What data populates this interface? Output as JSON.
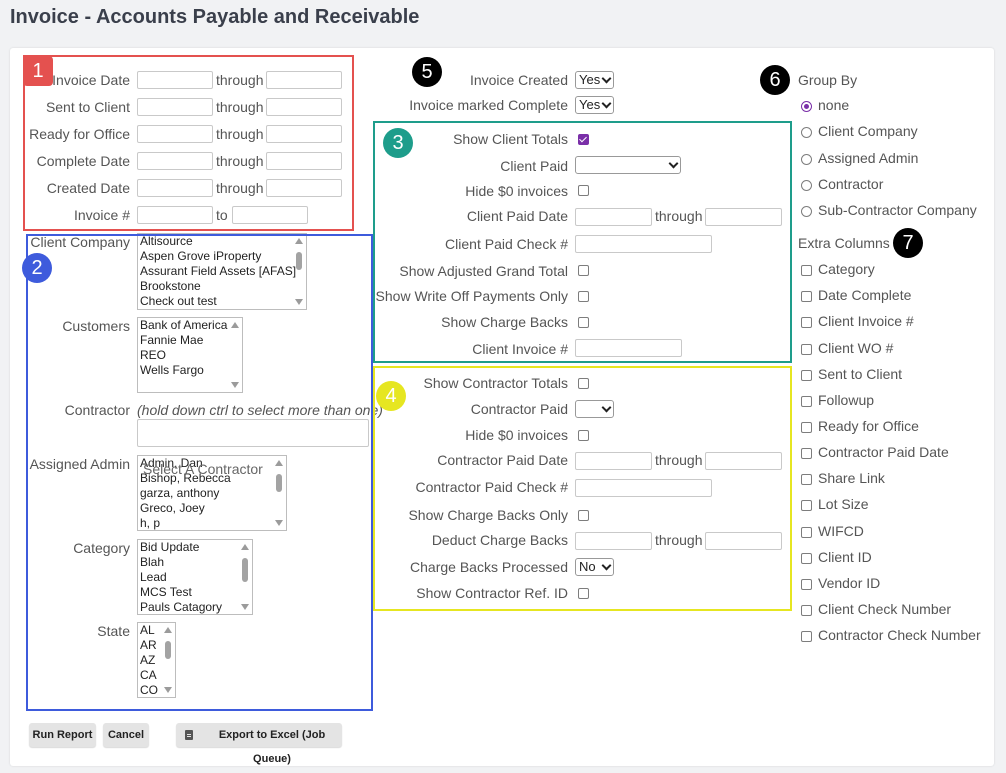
{
  "page": {
    "title": "Invoice - Accounts Payable and Receivable"
  },
  "colors": {
    "box1": "#e4514f",
    "box2": "#3e5bdc",
    "box3": "#1e9d8b",
    "box4": "#e6e621",
    "badge_black": "#000000",
    "accent": "#7a2fa8"
  },
  "badges": {
    "b1": "1",
    "b2": "2",
    "b3": "3",
    "b4": "4",
    "b5": "5",
    "b6": "6",
    "b7": "7"
  },
  "dates": {
    "invoice_date": "Invoice Date",
    "sent_to_client": "Sent to Client",
    "ready_for_office": "Ready for Office",
    "complete_date": "Complete Date",
    "created_date": "Created Date",
    "invoice_num": "Invoice #",
    "through": "through",
    "to": "to"
  },
  "filters": {
    "client_company": "Client Company",
    "client_company_options": [
      "Altisource",
      "Aspen Grove iProperty",
      "Assurant Field Assets [AFAS]",
      "Brookstone",
      "Check out test"
    ],
    "customers": "Customers",
    "customers_options": [
      "Bank of America",
      "Fannie Mae",
      "REO",
      "Wells Fargo"
    ],
    "contractor": "Contractor",
    "contractor_hint": "(hold down ctrl to select more than one)",
    "contractor_placeholder": "Select A Contractor",
    "assigned_admin": "Assigned Admin",
    "assigned_admin_options": [
      "Admin, Dan",
      "Bishop, Rebecca",
      "garza, anthony",
      "Greco, Joey",
      "h, p"
    ],
    "category": "Category",
    "category_options": [
      "Bid Update",
      "Blah",
      "Lead",
      "MCS Test",
      "Pauls Catagory"
    ],
    "state": "State",
    "state_options": [
      "AL",
      "AR",
      "AZ",
      "CA",
      "CO"
    ]
  },
  "invoice_flags": {
    "invoice_created": "Invoice Created",
    "invoice_created_value": "Yes",
    "invoice_marked_complete": "Invoice marked Complete",
    "invoice_marked_complete_value": "Yes"
  },
  "client": {
    "show_client_totals": "Show Client Totals",
    "client_paid": "Client Paid",
    "hide_zero": "Hide $0 invoices",
    "client_paid_date": "Client Paid Date",
    "client_paid_check": "Client Paid Check #",
    "show_adjusted": "Show Adjusted Grand Total",
    "show_write_off": "Show Write Off Payments Only",
    "show_charge_backs": "Show Charge Backs",
    "client_invoice": "Client Invoice #"
  },
  "contractor_section": {
    "show_contractor_totals": "Show Contractor Totals",
    "contractor_paid": "Contractor Paid",
    "hide_zero": "Hide $0 invoices",
    "contractor_paid_date": "Contractor Paid Date",
    "contractor_paid_check": "Contractor Paid Check #",
    "show_charge_backs_only": "Show Charge Backs Only",
    "deduct_charge_backs": "Deduct Charge Backs",
    "charge_backs_processed": "Charge Backs Processed",
    "charge_backs_processed_value": "No",
    "show_contractor_ref": "Show Contractor Ref. ID"
  },
  "group_by": {
    "title": "Group By",
    "options": [
      "none",
      "Client Company",
      "Assigned Admin",
      "Contractor",
      "Sub-Contractor Company"
    ]
  },
  "extra_columns": {
    "title": "Extra Columns",
    "options": [
      "Category",
      "Date Complete",
      "Client Invoice #",
      "Client WO #",
      "Sent to Client",
      "Followup",
      "Ready for Office",
      "Contractor Paid Date",
      "Share Link",
      "Lot Size",
      "WIFCD",
      "Client ID",
      "Vendor ID",
      "Client Check Number",
      "Contractor Check Number"
    ]
  },
  "buttons": {
    "run_report": "Run Report",
    "cancel": "Cancel",
    "export": "Export to Excel (Job Queue)"
  }
}
